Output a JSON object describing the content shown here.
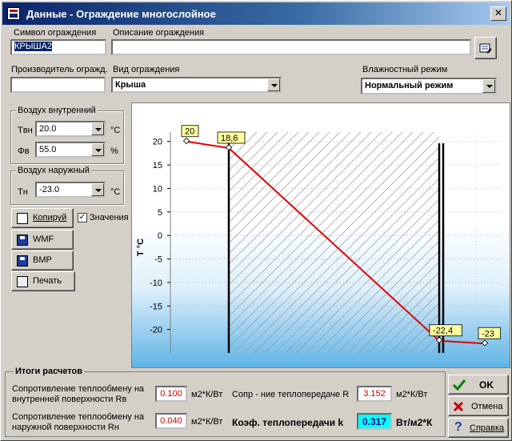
{
  "window": {
    "title": "Данные - Ограждение многослойное",
    "close": "✕"
  },
  "form": {
    "symbol_label": "Символ ограждения",
    "symbol_value": "КРЫША2",
    "desc_label": "Описание ограждения",
    "desc_value": "",
    "maker_label": "Производитель огражд.",
    "maker_value": "",
    "type_label": "Вид ограждения",
    "type_value": "Крыша",
    "humid_label": "Влажностный режим",
    "humid_value": "Нормальный режим"
  },
  "air_in": {
    "title": "Воздух внутренний",
    "t_label": "Tвн",
    "t_value": "20.0",
    "t_unit": "°C",
    "phi_label": "Φв",
    "phi_value": "55.0",
    "phi_unit": "%"
  },
  "air_out": {
    "title": "Воздух наружный",
    "t_label": "Tн",
    "t_value": "-23.0",
    "t_unit": "°C"
  },
  "buttons": {
    "copy": "Копируй",
    "wmf": "WMF",
    "bmp": "BMP",
    "print": "Печать",
    "ok": "OK",
    "cancel": "Отмена",
    "help": "Справка"
  },
  "values_check": {
    "label": "Значения",
    "checked": "✓"
  },
  "chart_data": {
    "type": "line",
    "ylabel": "T °C",
    "ylim": [
      -25,
      22
    ],
    "yticks": [
      20,
      15,
      10,
      5,
      0,
      -5,
      -10,
      -15,
      -20
    ],
    "series": [
      {
        "points": [
          [
            0,
            20
          ],
          [
            1,
            18.6
          ],
          [
            2,
            -22.4
          ],
          [
            3,
            -23
          ]
        ]
      }
    ],
    "labels": [
      "20",
      "18,6",
      "-22,4",
      "-23"
    ]
  },
  "results": {
    "title": "Итоги расчетов",
    "rb_label1": "Сопротивление теплообмену на",
    "rb_label2": "внутренней поверхности Rв",
    "rb_value": "0.100",
    "rb_unit": "м2*К/Вт",
    "rh_label1": "Сопротивление теплообмену на",
    "rh_label2": "наружной поверхности Rн",
    "rh_value": "0.040",
    "rh_unit": "м2*К/Вт",
    "r_label": "Сопр - ние теплопередаче R",
    "r_value": "3.152",
    "r_unit": "м2*К/Вт",
    "k_label": "Коэф. теплопередачи k",
    "k_value": "0.317",
    "k_unit": "Вт/м2*К"
  }
}
